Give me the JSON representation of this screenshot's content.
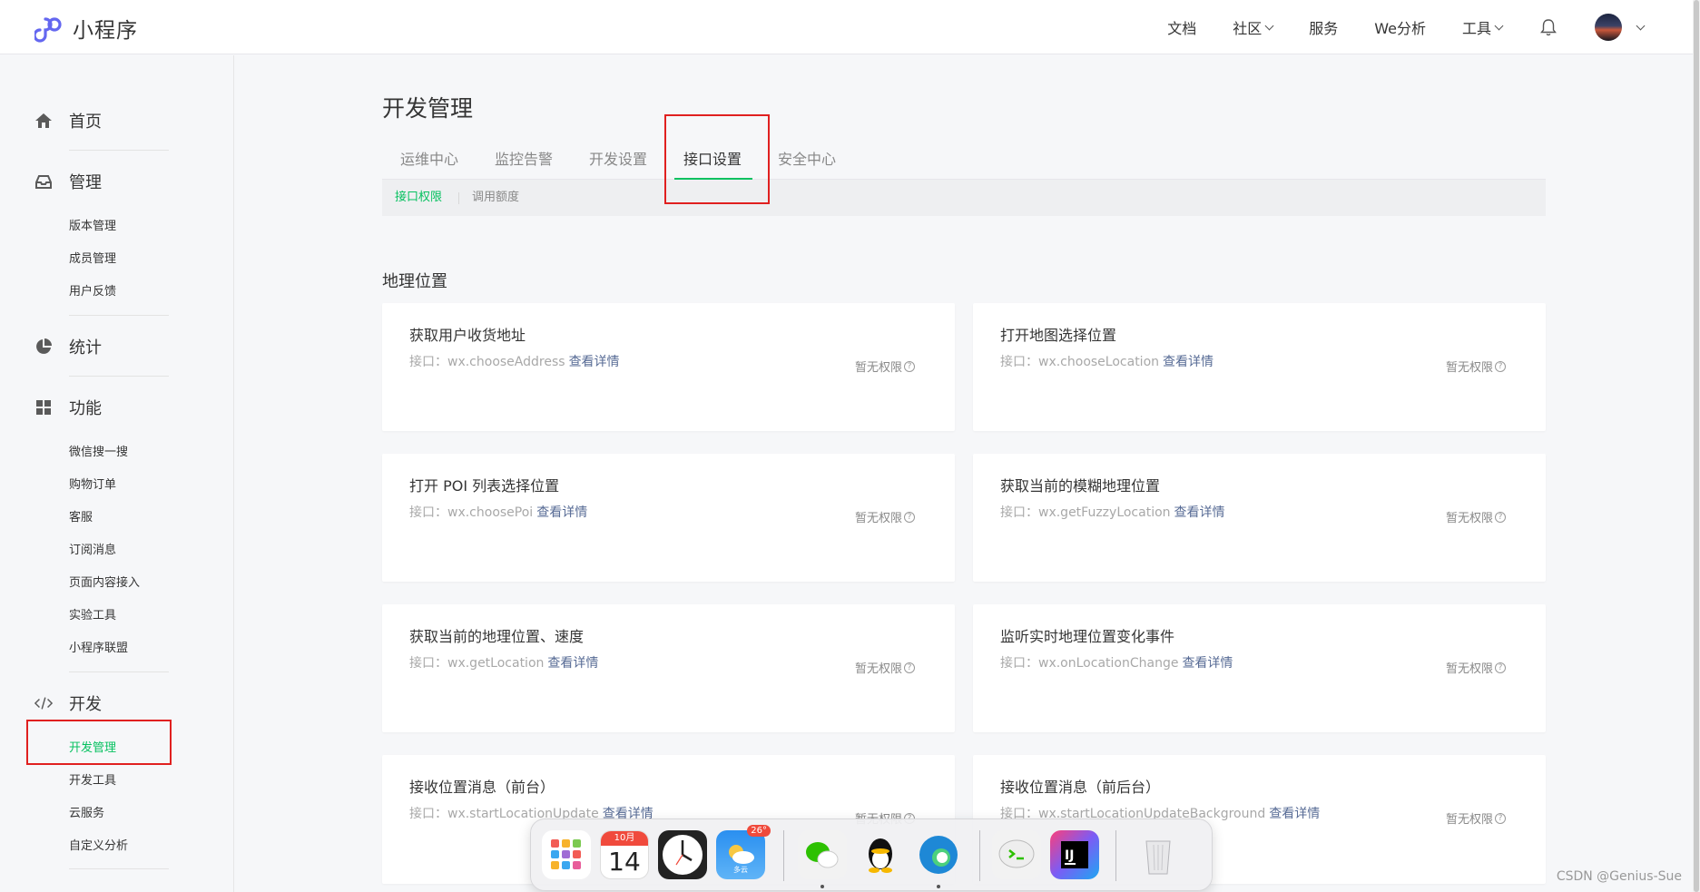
{
  "brand": {
    "name": "小程序"
  },
  "topnav": {
    "items": [
      "文档",
      "社区",
      "服务",
      "We分析",
      "工具"
    ]
  },
  "sidebar": {
    "groups": [
      {
        "label": "首页",
        "icon": "home-icon",
        "items": []
      },
      {
        "label": "管理",
        "icon": "inbox-icon",
        "items": [
          "版本管理",
          "成员管理",
          "用户反馈"
        ]
      },
      {
        "label": "统计",
        "icon": "pie-chart-icon",
        "items": []
      },
      {
        "label": "功能",
        "icon": "grid-icon",
        "items": [
          "微信搜一搜",
          "购物订单",
          "客服",
          "订阅消息",
          "页面内容接入",
          "实验工具",
          "小程序联盟"
        ]
      },
      {
        "label": "开发",
        "icon": "code-icon",
        "items": [
          "开发管理",
          "开发工具",
          "云服务",
          "自定义分析"
        ]
      }
    ],
    "active_item": "开发管理"
  },
  "main": {
    "title": "开发管理",
    "tabs": [
      "运维中心",
      "监控告警",
      "开发设置",
      "接口设置",
      "安全中心"
    ],
    "active_tab": "接口设置",
    "subtabs": [
      "接口权限",
      "调用额度"
    ],
    "active_subtab": "接口权限",
    "section_title": "地理位置",
    "api_prefix": "接口：",
    "detail_label": "查看详情",
    "status_label": "暂无权限",
    "cards": [
      {
        "title": "获取用户收货地址",
        "api": "wx.chooseAddress"
      },
      {
        "title": "打开地图选择位置",
        "api": "wx.chooseLocation"
      },
      {
        "title": "打开 POI 列表选择位置",
        "api": "wx.choosePoi"
      },
      {
        "title": "获取当前的模糊地理位置",
        "api": "wx.getFuzzyLocation"
      },
      {
        "title": "获取当前的地理位置、速度",
        "api": "wx.getLocation"
      },
      {
        "title": "监听实时地理位置变化事件",
        "api": "wx.onLocationChange"
      },
      {
        "title": "接收位置消息（前台）",
        "api": "wx.startLocationUpdate"
      },
      {
        "title": "接收位置消息（前后台）",
        "api": "wx.startLocationUpdateBackground"
      }
    ]
  },
  "dock": {
    "calendar_month": "10月",
    "calendar_day": "14",
    "weather_temp": "26°",
    "weather_text": "多云",
    "apps": [
      "launchpad-icon",
      "calendar-icon",
      "clock-icon",
      "weather-icon",
      "wechat-icon",
      "qq-icon",
      "edge-icon",
      "wechat-devtools-icon",
      "intellij-icon",
      "trash-icon"
    ]
  },
  "watermark": "CSDN @Genius-Sue",
  "colors": {
    "accent": "#07c160",
    "link": "#576b95",
    "annotation": "#e02020"
  }
}
